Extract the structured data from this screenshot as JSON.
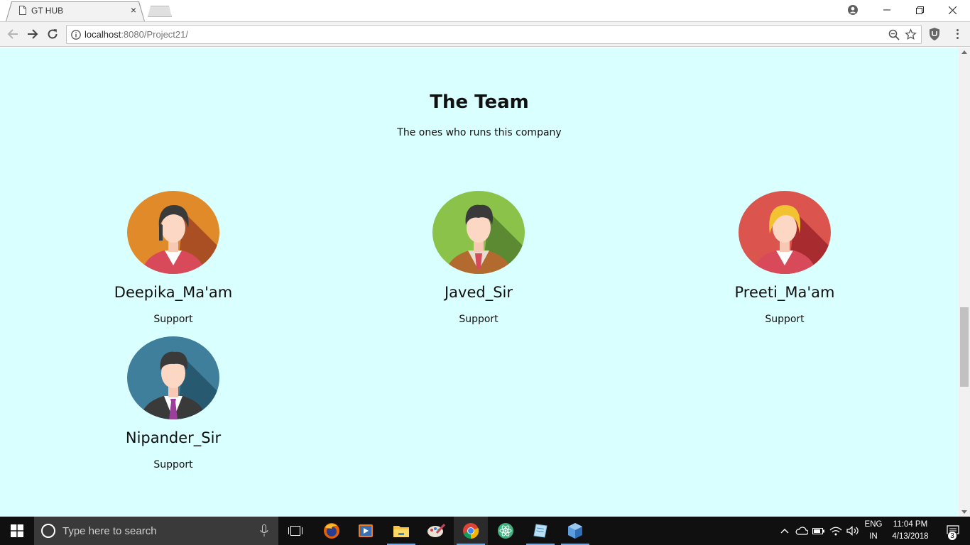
{
  "browser": {
    "tab_title": "GT HUB",
    "tab_close": "×",
    "url_host": "localhost",
    "url_rest": ":8080/Project21/"
  },
  "page": {
    "title": "The Team",
    "subtitle": "The ones who runs this company",
    "members": [
      {
        "name": "Deepika_Ma'am",
        "role": "Support",
        "avatar_color": "#e08a2a"
      },
      {
        "name": "Javed_Sir",
        "role": "Support",
        "avatar_color": "#8bc34a"
      },
      {
        "name": "Preeti_Ma'am",
        "role": "Support",
        "avatar_color": "#dc544e"
      },
      {
        "name": "Nipander_Sir",
        "role": "Support",
        "avatar_color": "#3f7f9c"
      }
    ]
  },
  "taskbar": {
    "search_placeholder": "Type here to search",
    "language": "ENG",
    "region": "IN",
    "time": "11:04 PM",
    "date": "4/13/2018",
    "notification_count": "3"
  },
  "colors": {
    "page_bg": "#d9ffff",
    "taskbar_bg": "#101010"
  }
}
